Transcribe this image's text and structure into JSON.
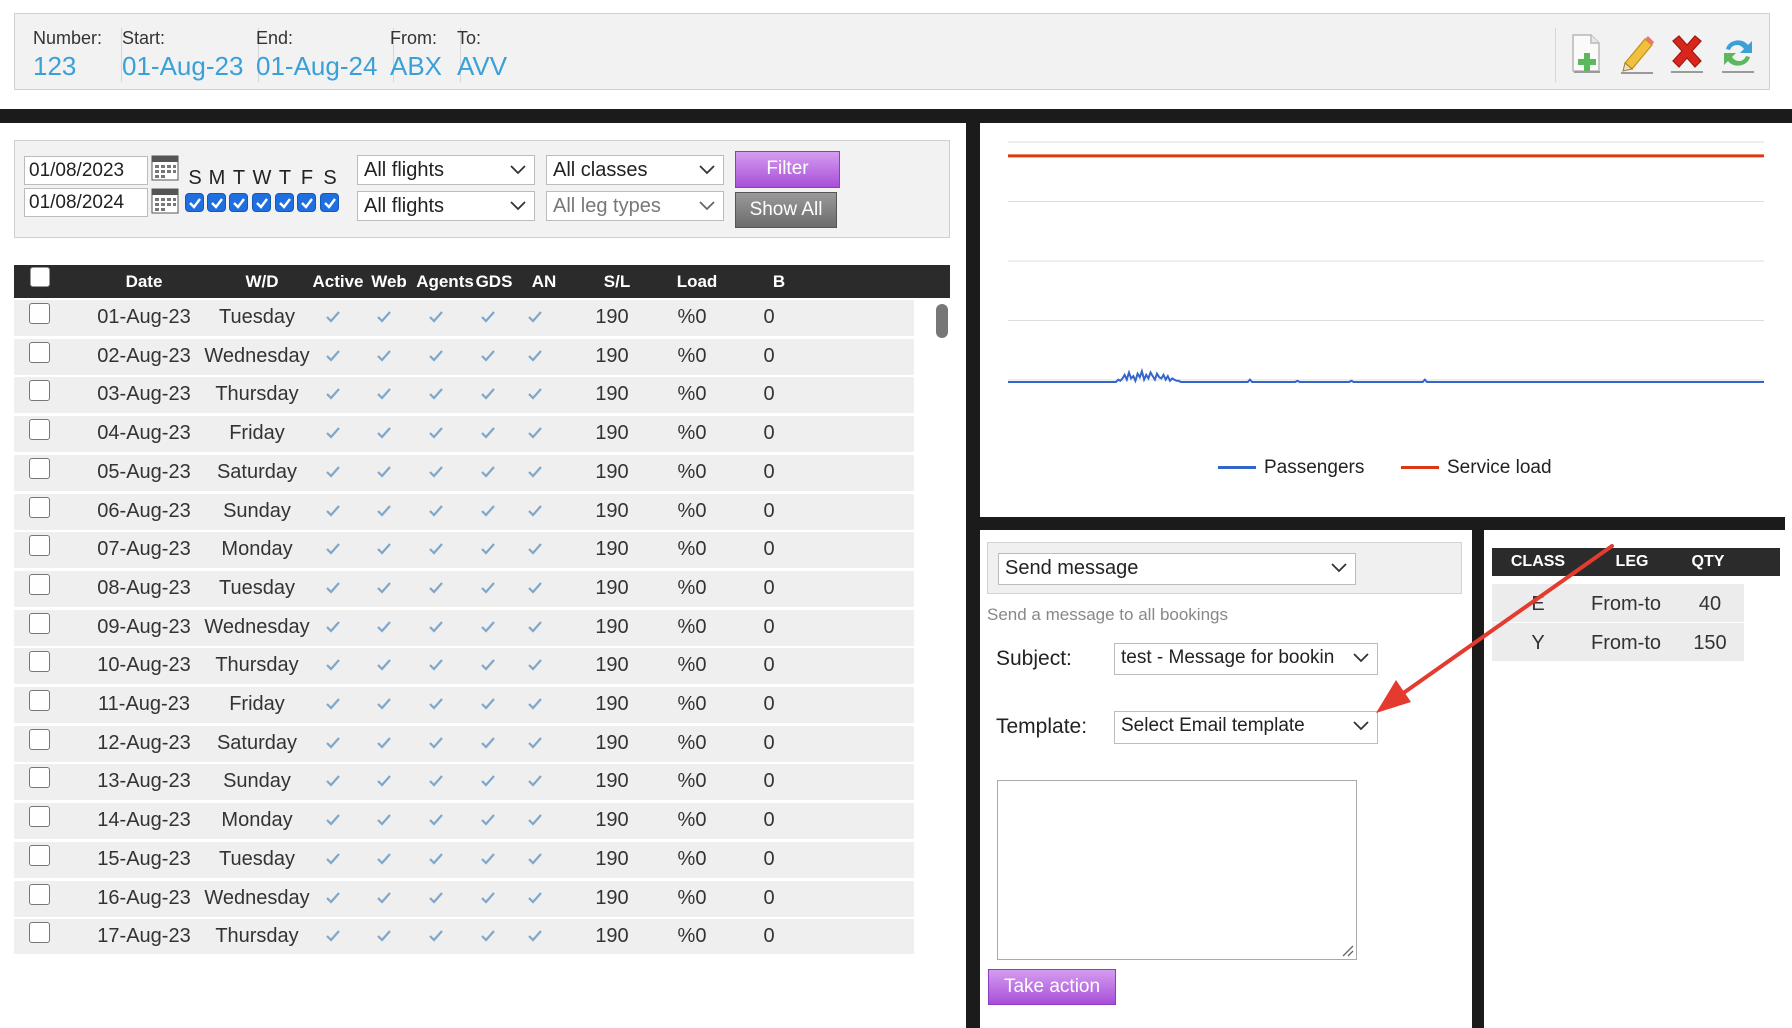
{
  "header": {
    "number_label": "Number:",
    "number_value": "123",
    "start_label": "Start:",
    "start_value": "01-Aug-23",
    "end_label": "End:",
    "end_value": "01-Aug-24",
    "from_label": "From:",
    "from_value": "ABX",
    "to_label": "To:",
    "to_value": "AVV",
    "icons": [
      "add-document-icon",
      "edit-pencil-icon",
      "delete-x-icon",
      "sync-arrows-icon"
    ]
  },
  "filters": {
    "start_date": "01/08/2023",
    "end_date": "01/08/2024",
    "days": [
      "S",
      "M",
      "T",
      "W",
      "T",
      "F",
      "S"
    ],
    "days_checked": [
      true,
      true,
      true,
      true,
      true,
      true,
      true
    ],
    "flights_select_1": "All flights",
    "flights_select_2": "All flights",
    "classes_select": "All classes",
    "leg_types_select": "All leg types",
    "filter_button": "Filter",
    "show_all_button": "Show All"
  },
  "table": {
    "columns": [
      "Date",
      "W/D",
      "Active",
      "Web",
      "Agents",
      "GDS",
      "AN",
      "S/L",
      "Load",
      "B"
    ],
    "rows": [
      {
        "date": "01-Aug-23",
        "wd": "Tuesday",
        "sl": "190",
        "load": "%0",
        "b": "0"
      },
      {
        "date": "02-Aug-23",
        "wd": "Wednesday",
        "sl": "190",
        "load": "%0",
        "b": "0"
      },
      {
        "date": "03-Aug-23",
        "wd": "Thursday",
        "sl": "190",
        "load": "%0",
        "b": "0"
      },
      {
        "date": "04-Aug-23",
        "wd": "Friday",
        "sl": "190",
        "load": "%0",
        "b": "0"
      },
      {
        "date": "05-Aug-23",
        "wd": "Saturday",
        "sl": "190",
        "load": "%0",
        "b": "0"
      },
      {
        "date": "06-Aug-23",
        "wd": "Sunday",
        "sl": "190",
        "load": "%0",
        "b": "0"
      },
      {
        "date": "07-Aug-23",
        "wd": "Monday",
        "sl": "190",
        "load": "%0",
        "b": "0"
      },
      {
        "date": "08-Aug-23",
        "wd": "Tuesday",
        "sl": "190",
        "load": "%0",
        "b": "0"
      },
      {
        "date": "09-Aug-23",
        "wd": "Wednesday",
        "sl": "190",
        "load": "%0",
        "b": "0"
      },
      {
        "date": "10-Aug-23",
        "wd": "Thursday",
        "sl": "190",
        "load": "%0",
        "b": "0"
      },
      {
        "date": "11-Aug-23",
        "wd": "Friday",
        "sl": "190",
        "load": "%0",
        "b": "0"
      },
      {
        "date": "12-Aug-23",
        "wd": "Saturday",
        "sl": "190",
        "load": "%0",
        "b": "0"
      },
      {
        "date": "13-Aug-23",
        "wd": "Sunday",
        "sl": "190",
        "load": "%0",
        "b": "0"
      },
      {
        "date": "14-Aug-23",
        "wd": "Monday",
        "sl": "190",
        "load": "%0",
        "b": "0"
      },
      {
        "date": "15-Aug-23",
        "wd": "Tuesday",
        "sl": "190",
        "load": "%0",
        "b": "0"
      },
      {
        "date": "16-Aug-23",
        "wd": "Wednesday",
        "sl": "190",
        "load": "%0",
        "b": "0"
      },
      {
        "date": "17-Aug-23",
        "wd": "Thursday",
        "sl": "190",
        "load": "%0",
        "b": "0"
      }
    ]
  },
  "chart": {
    "legend": [
      {
        "name": "Passengers",
        "color": "#3366cc"
      },
      {
        "name": "Service load",
        "color": "#dc3912"
      }
    ]
  },
  "chart_data": {
    "type": "line",
    "title": "",
    "series": [
      {
        "name": "Passengers",
        "color": "#3366cc",
        "values": [
          0,
          0,
          0,
          0,
          0,
          0,
          0,
          0,
          0,
          0,
          0,
          0,
          0,
          0,
          0,
          0,
          0,
          0,
          0,
          0,
          0,
          0,
          0,
          0,
          0,
          0,
          0,
          0,
          0,
          0,
          0,
          0,
          0,
          0,
          0,
          0,
          0,
          0,
          0,
          0,
          0,
          0,
          0,
          0,
          0,
          0,
          0,
          0,
          0,
          0,
          0,
          2,
          1,
          3,
          6,
          2,
          8,
          3,
          5,
          1,
          7,
          4,
          9,
          2,
          6,
          3,
          8,
          5,
          2,
          7,
          4,
          3,
          6,
          2,
          5,
          1,
          3,
          2,
          1,
          1,
          0,
          0,
          0,
          0,
          0,
          0,
          0,
          0,
          0,
          0,
          0,
          0,
          0,
          0,
          0,
          0,
          0,
          0,
          0,
          0,
          0,
          0,
          0,
          0,
          0,
          0,
          0,
          0,
          0,
          0,
          0,
          0,
          2,
          0,
          0,
          0,
          0,
          0,
          0,
          0,
          0,
          0,
          0,
          0,
          0,
          0,
          0,
          0,
          0,
          0,
          0,
          0,
          0,
          0,
          1,
          0,
          0,
          0,
          0,
          0,
          0,
          0,
          0,
          0,
          0,
          0,
          0,
          0,
          0,
          0,
          0,
          0,
          0,
          0,
          0,
          0,
          0,
          0,
          0,
          1,
          0,
          0,
          0,
          0,
          0,
          0,
          0,
          0,
          0,
          0,
          0,
          0,
          0,
          0,
          0,
          0,
          0,
          0,
          0,
          0,
          0,
          0,
          0,
          0,
          0,
          0,
          0,
          0,
          0,
          0,
          0,
          0,
          0,
          2,
          0,
          0,
          0,
          0,
          0,
          0,
          0,
          0,
          0,
          0,
          0,
          0,
          0,
          0,
          0,
          0,
          0,
          0,
          0,
          0,
          0,
          0,
          0,
          0,
          0,
          0,
          0,
          0,
          0,
          0,
          0,
          0,
          0,
          0,
          0,
          0,
          0,
          0,
          0,
          0,
          0,
          0,
          0,
          0,
          0,
          0,
          0,
          0,
          0,
          0,
          0,
          0,
          0,
          0,
          0,
          0,
          0,
          0,
          0,
          0,
          0,
          0,
          0,
          0,
          0,
          0,
          0,
          0,
          0,
          0,
          0,
          0,
          0,
          0,
          0,
          0,
          0,
          0,
          0,
          0,
          0,
          0,
          0,
          0,
          0,
          0,
          0,
          0,
          0,
          0,
          0,
          0,
          0,
          0,
          0,
          0,
          0,
          0,
          0,
          0,
          0,
          0,
          0,
          0,
          0,
          0,
          0,
          0,
          0,
          0,
          0,
          0,
          0,
          0,
          0,
          0,
          0,
          0,
          0,
          0,
          0,
          0,
          0,
          0,
          0,
          0,
          0,
          0,
          0,
          0,
          0,
          0,
          0,
          0,
          0,
          0,
          0,
          0,
          0,
          0,
          0,
          0,
          0,
          0,
          0,
          0,
          0,
          0,
          0,
          0,
          0,
          0,
          0,
          0,
          0,
          0,
          0
        ]
      },
      {
        "name": "Service load",
        "color": "#dc3912",
        "values": [
          190,
          190
        ]
      }
    ],
    "ylim": [
      0,
      200
    ],
    "grid": true,
    "legend": "bottom"
  },
  "message": {
    "action_select": "Send message",
    "hint": "Send a message to all bookings",
    "subject_label": "Subject:",
    "subject_value": "test - Message for bookin",
    "template_label": "Template:",
    "template_value": "Select Email template",
    "body": "",
    "take_action_button": "Take action"
  },
  "class_table": {
    "columns": [
      "CLASS",
      "LEG",
      "QTY"
    ],
    "rows": [
      {
        "class": "E",
        "leg": "From-to",
        "qty": "40"
      },
      {
        "class": "Y",
        "leg": "From-to",
        "qty": "150"
      }
    ]
  },
  "accent_colors": {
    "link_blue": "#3aa0d8",
    "purple": "#a84fd8",
    "arrow_red": "#e33b2e"
  }
}
